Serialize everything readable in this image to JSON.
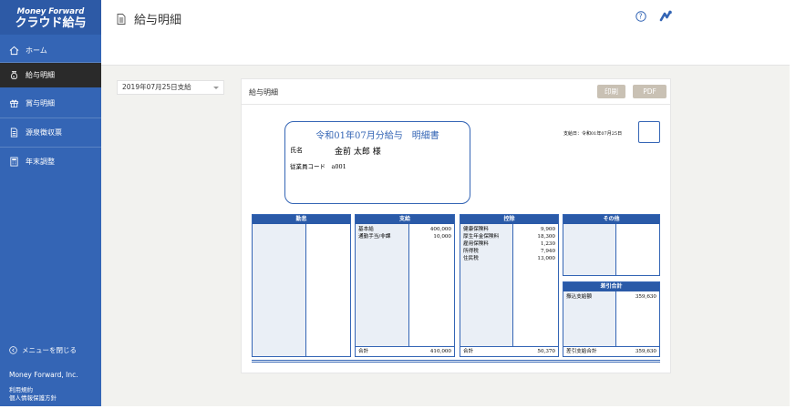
{
  "sidebar": {
    "logo_line1": "Money Forward",
    "logo_line2": "クラウド給与",
    "items": [
      {
        "label": "ホーム",
        "icon": "home-icon"
      },
      {
        "label": "給与明細",
        "icon": "money-bag-icon",
        "active": true
      },
      {
        "label": "賞与明細",
        "icon": "gift-icon"
      },
      {
        "label": "源泉徴収票",
        "icon": "document-icon"
      },
      {
        "label": "年末調整",
        "icon": "calculator-icon"
      }
    ],
    "close_menu": "メニューを閉じる",
    "company": "Money Forward, Inc.",
    "terms": "利用規約",
    "privacy": "個人情報保護方針"
  },
  "header": {
    "title": "給与明細"
  },
  "select": {
    "value": "2019年07月25日支給"
  },
  "card": {
    "title": "給与明細",
    "print_label": "印刷",
    "pdf_label": "PDF"
  },
  "statement": {
    "title": "令和01年07月分給与　明細書",
    "name_label": "氏名",
    "name": "金前 太郎 様",
    "employee_code": "従業員コード　a001",
    "pay_date": "支給日：令和01年07月25日"
  },
  "tables": {
    "attendance": {
      "header": "勤怠"
    },
    "payments": {
      "header": "支給",
      "labels": [
        "基本給",
        "通勤手当/非課"
      ],
      "values": [
        "400,000",
        "10,000"
      ],
      "total_label": "合計",
      "total": "410,000"
    },
    "deductions": {
      "header": "控除",
      "labels": [
        "健康保険料",
        "厚生年金保険料",
        "雇用保険料",
        "所得税",
        "住民税"
      ],
      "values": [
        "9,900",
        "18,300",
        "1,230",
        "7,940",
        "13,000"
      ],
      "total_label": "合計",
      "total": "50,370"
    },
    "other": {
      "header": "その他"
    },
    "net": {
      "header": "差引合計",
      "label": "振込支給額",
      "value": "359,630",
      "total_label": "差引支給合計",
      "total": "359,630"
    }
  },
  "colors": {
    "sidebar": "#3465b5",
    "table_header": "#2a5aa8",
    "button": "#c9c1b4"
  }
}
